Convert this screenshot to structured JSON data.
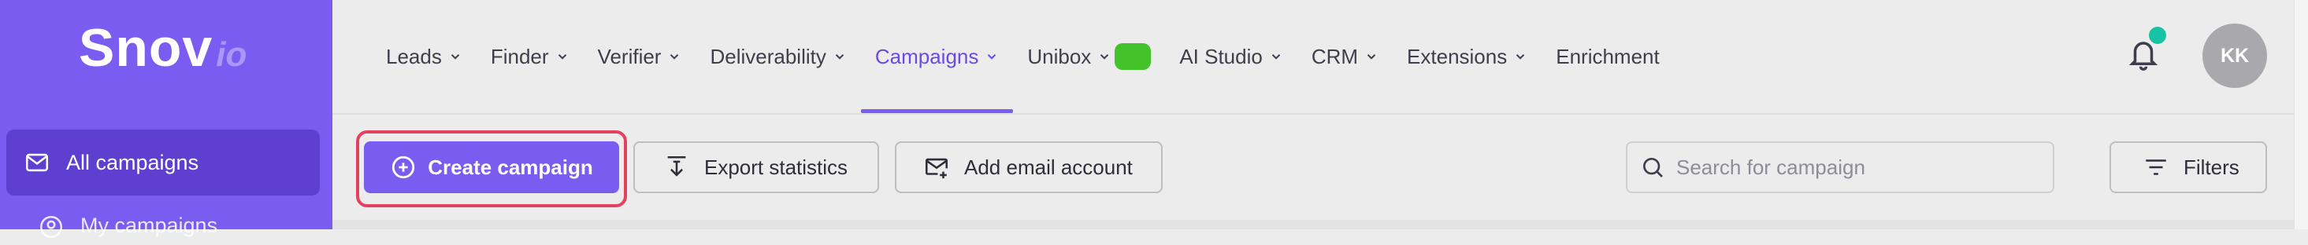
{
  "brand": {
    "main": "Snov",
    "sub": "io"
  },
  "sidebar": {
    "items": [
      {
        "label": "All campaigns",
        "icon": "mail-icon",
        "active": true
      },
      {
        "label": "My campaigns",
        "icon": "user-circle-icon",
        "active": false
      }
    ]
  },
  "nav": {
    "items": [
      {
        "label": "Leads",
        "dropdown": true
      },
      {
        "label": "Finder",
        "dropdown": true
      },
      {
        "label": "Verifier",
        "dropdown": true
      },
      {
        "label": "Deliverability",
        "dropdown": true
      },
      {
        "label": "Campaigns",
        "dropdown": true,
        "active": true
      },
      {
        "label": "Unibox",
        "dropdown": true,
        "badge_color": "#43c22a"
      },
      {
        "label": "AI Studio",
        "dropdown": true
      },
      {
        "label": "CRM",
        "dropdown": true
      },
      {
        "label": "Extensions",
        "dropdown": true
      },
      {
        "label": "Enrichment",
        "dropdown": false
      }
    ]
  },
  "user": {
    "initials": "KK",
    "notification_dot_color": "#17c3a2"
  },
  "toolbar": {
    "create_label": "Create campaign",
    "export_label": "Export statistics",
    "add_email_label": "Add email account",
    "filters_label": "Filters"
  },
  "search": {
    "placeholder": "Search for campaign",
    "value": ""
  },
  "colors": {
    "accent": "#7b5cf0",
    "highlight_outline": "#e5405e"
  }
}
